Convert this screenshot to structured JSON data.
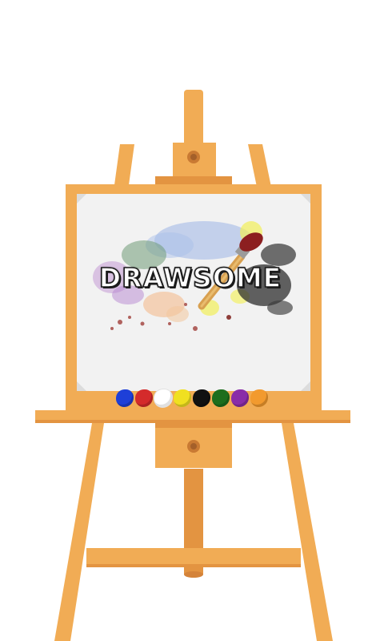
{
  "app": {
    "logo_text": "DRAWSOME"
  },
  "palette": {
    "colors": [
      "#1e3fd8",
      "#d42b2b",
      "#ffffff",
      "#f0e020",
      "#111111",
      "#1d6e1d",
      "#8a2ca8",
      "#f29a2e"
    ]
  },
  "theme": {
    "wood": "#f1ac55",
    "wood_shade": "#e39441",
    "wood_light": "#f6c27a",
    "canvas": "#f2f2f2"
  },
  "icons": {
    "brush": "paintbrush-icon",
    "knob": "easel-knob-icon"
  }
}
